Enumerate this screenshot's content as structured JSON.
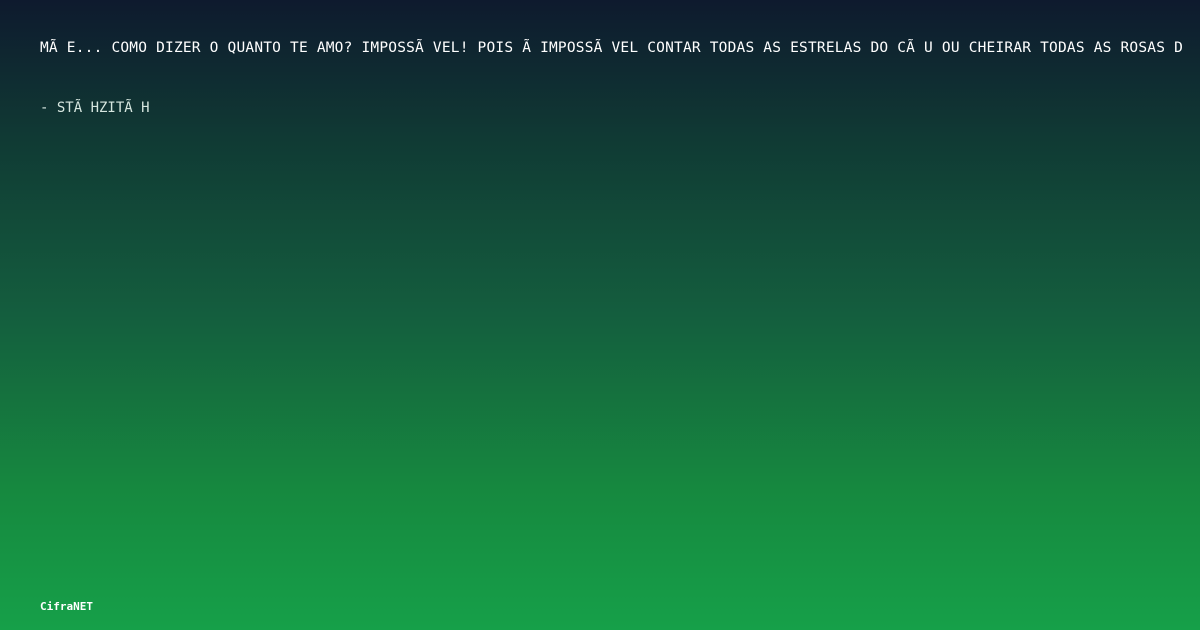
{
  "quote": {
    "text": "MÃ E... COMO DIZER O QUANTO TE AMO? IMPOSSÃ VEL! POIS Ã  IMPOSSÃ VEL CONTAR TODAS AS ESTRELAS DO CÃ U OU CHEIRAR TODAS AS ROSAS D",
    "author": "- STÃ HZITÃ H"
  },
  "brand": {
    "label": "CifraNET"
  }
}
